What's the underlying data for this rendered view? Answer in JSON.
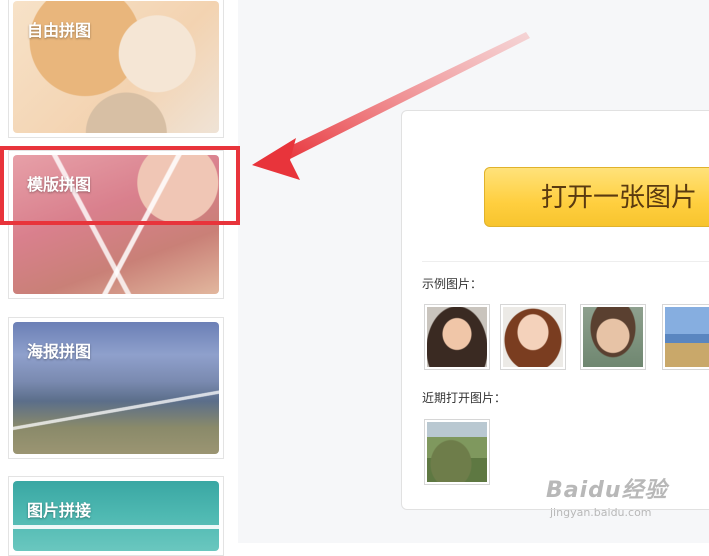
{
  "sidebar": {
    "modes": [
      {
        "label": "自由拼图"
      },
      {
        "label": "模版拼图"
      },
      {
        "label": "海报拼图"
      },
      {
        "label": "图片拼接"
      }
    ]
  },
  "main": {
    "open_button_label": "打开一张图片",
    "examples_label": "示例图片：",
    "recent_label": "近期打开图片："
  },
  "watermark": {
    "text": "Baidu经验",
    "subtext": "jingyan.baidu.com"
  },
  "colors": {
    "highlight": "#e8343b",
    "button": "#ffcf3f"
  }
}
